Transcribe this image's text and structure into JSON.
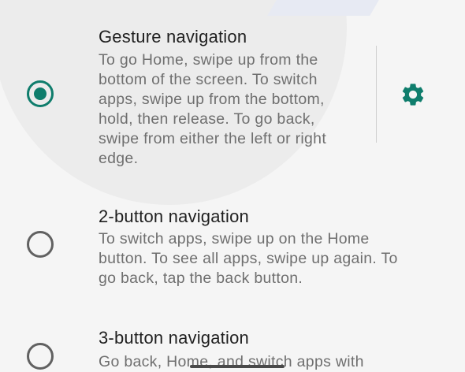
{
  "options": [
    {
      "title": "Gesture navigation",
      "selected": true,
      "description_lines": [
        "To go Home, swipe up from the",
        "bottom of the screen. To switch",
        "apps, swipe up from the bottom,",
        "hold, then release. To go back,",
        "swipe from either the left or right",
        "edge."
      ],
      "settings_icon": "gear-icon"
    },
    {
      "title": "2-button navigation",
      "selected": false,
      "description_lines": [
        "To switch apps, swipe up on the Home",
        "button. To see all apps, swipe up again. To",
        "go back, tap the back button."
      ]
    },
    {
      "title": "3-button navigation",
      "selected": false,
      "description_lines": [
        "Go back, Home, and switch apps with"
      ]
    }
  ],
  "colors": {
    "accent": "#0f7d6c",
    "radio_unchecked": "#616161",
    "title": "#1f1f1f",
    "description": "#6f6f6f",
    "background": "#f5f5f5"
  },
  "icons": {
    "radio_checked": "radio-checked-icon",
    "radio_unchecked": "radio-unchecked-icon",
    "settings": "gear-icon",
    "home_handle": "gesture-handle"
  }
}
